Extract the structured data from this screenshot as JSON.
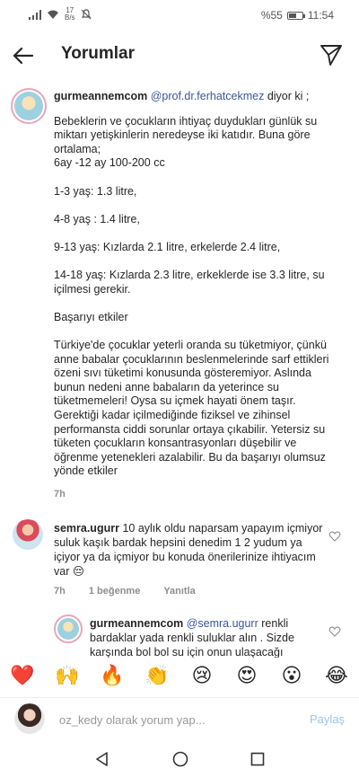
{
  "status_bar": {
    "speed_value": "17",
    "speed_unit": "B/s",
    "battery": "%55",
    "battery_level": 0.55,
    "time": "11:54"
  },
  "header": {
    "title": "Yorumlar"
  },
  "caption": {
    "username": "gurmeannemcom",
    "mention": "@prof.dr.ferhatcekmez",
    "says": "diyor ki ;",
    "body": "Bebeklerin ve çocukların ihtiyaç duydukları günlük su miktarı yetişkinlerin neredeyse iki katıdır. Buna göre ortalama;\n6ay -12 ay 100-200 cc\n\n1-3 yaş: 1.3 litre,\n\n4-8 yaş : 1.4 litre,\n\n9-13 yaş: Kızlarda 2.1 litre, erkelerde 2.4 litre,\n\n14-18 yaş: Kızlarda 2.3 litre, erkeklerde ise 3.3 litre, su içilmesi gerekir.\n\nBaşarıyı etkiler\n\nTürkiye'de çocuklar yeterli oranda su tüketmiyor, çünkü anne babalar çocuklarının beslenmelerinde sarf ettikleri özeni sıvı tüketimi konusunda gösteremiyor. Aslında bunun nedeni anne babaların da yeterince su tüketmemeleri! Oysa su içmek hayati önem taşır. Gerektiği kadar içilmediğinde fiziksel ve zihinsel performansta ciddi sorunlar ortaya çıkabilir. Yetersiz su tüketen çocukların konsantrasyonları düşebilir ve öğrenme yetenekleri azalabilir. Bu da başarıyı olumsuz yönde etkiler",
    "time": "7h"
  },
  "comments": [
    {
      "username": "semra.ugurr",
      "text": "10 aylık oldu naparsam yapayım içmiyor suluk kaşık bardak hepsini denedim 1 2 yudum ya içiyor ya da içmiyor bu konuda önerilerinize ihtiyacım var 😔",
      "time": "7h",
      "likes": "1 beğenme",
      "reply_label": "Yanıtla"
    },
    {
      "username": "gurmeannemcom",
      "mention": "@semra.ugurr",
      "text": "renkli bardaklar yada renkli suluklar alın . Sizde karşında bol bol su için onun ulaşacağı"
    }
  ],
  "emoji_bar": [
    "❤️",
    "🙌",
    "🔥",
    "👏",
    "😢",
    "😍",
    "😮",
    "😂"
  ],
  "comment_input": {
    "placeholder": "oz_kedy olarak yorum yap...",
    "post_label": "Paylaş"
  },
  "icons": {
    "back": "arrow-left-icon",
    "send": "paper-plane-icon",
    "like": "heart-outline-icon",
    "nav_back": "triangle-back-icon",
    "nav_home": "circle-home-icon",
    "nav_recent": "square-recent-icon"
  },
  "colors": {
    "mention": "#385898",
    "secondary_text": "#8e8e8e",
    "post_button": "#9fc4e8",
    "story_ring": "#e8a7b8"
  }
}
